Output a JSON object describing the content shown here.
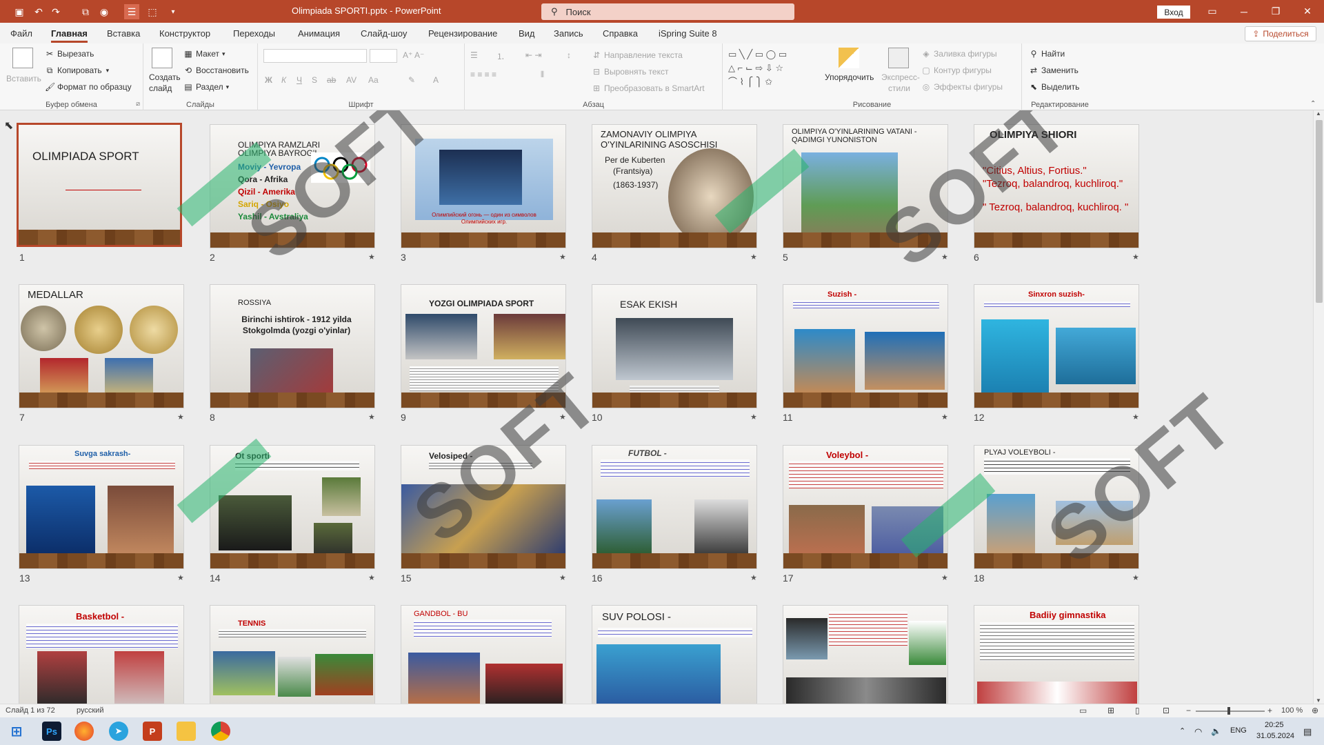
{
  "window": {
    "doc_title": "Olimpiada SPORTI.pptx - PowerPoint",
    "search_placeholder": "Поиск",
    "signin": "Вход"
  },
  "tabs": [
    "Файл",
    "Главная",
    "Вставка",
    "Конструктор",
    "Переходы",
    "Анимация",
    "Слайд-шоу",
    "Рецензирование",
    "Вид",
    "Запись",
    "Справка",
    "iSpring Suite 8"
  ],
  "share_label": "Поделиться",
  "ribbon": {
    "clipboard": {
      "label": "Буфер обмена",
      "paste": "Вставить",
      "cut": "Вырезать",
      "copy": "Копировать",
      "format_painter": "Формат по образцу"
    },
    "slides": {
      "label": "Слайды",
      "new_slide_1": "Создать",
      "new_slide_2": "слайд",
      "layout": "Макет",
      "reset": "Восстановить",
      "section": "Раздел"
    },
    "font": {
      "label": "Шрифт"
    },
    "paragraph": {
      "label": "Абзац",
      "text_direction": "Направление текста",
      "align_text": "Выровнять текст",
      "smartart": "Преобразовать в SmartArt"
    },
    "drawing": {
      "label": "Рисование",
      "arrange": "Упорядочить",
      "quick_styles_1": "Экспресс-",
      "quick_styles_2": "стили",
      "fill": "Заливка фигуры",
      "outline": "Контур фигуры",
      "effects": "Эффекты фигуры"
    },
    "editing": {
      "label": "Редактирование",
      "find": "Найти",
      "replace": "Заменить",
      "select": "Выделить"
    }
  },
  "slides": [
    {
      "n": "1",
      "title": "OLIMPIADA SPORT"
    },
    {
      "n": "2",
      "title": "OLIMPIYA RAMZLARI"
    },
    {
      "n": "3",
      "title": ""
    },
    {
      "n": "4",
      "title": "ZAMONAVIY OLIMPIYA"
    },
    {
      "n": "5",
      "title": "OLIMPIYA O'YINLARINING VATANI -"
    },
    {
      "n": "6",
      "title": "OLIMPIYA SHIORI"
    },
    {
      "n": "7",
      "title": "MEDALLAR"
    },
    {
      "n": "8",
      "title": "ROSSIYA"
    },
    {
      "n": "9",
      "title": "YOZGI OLIMPIADA SPORT"
    },
    {
      "n": "10",
      "title": "ESAK EKISH"
    },
    {
      "n": "11",
      "title": "Suzish -"
    },
    {
      "n": "12",
      "title": "Sinxron suzish-"
    },
    {
      "n": "13",
      "title": "Suvga sakrash-"
    },
    {
      "n": "14",
      "title": "Ot sporti"
    },
    {
      "n": "15",
      "title": "Velosiped -"
    },
    {
      "n": "16",
      "title": "FUTBOL -"
    },
    {
      "n": "17",
      "title": "Voleybol -"
    },
    {
      "n": "18",
      "title": "PLYAJ VOLEYBOLI -"
    },
    {
      "n": "19",
      "title": "Basketbol -"
    },
    {
      "n": "20",
      "title": "TENNIS"
    },
    {
      "n": "21",
      "title": "GANDBOL - BU"
    },
    {
      "n": "22",
      "title": "SUV POLOSI -"
    },
    {
      "n": "23",
      "title": ""
    },
    {
      "n": "24",
      "title": "Badiiy gimnastika"
    }
  ],
  "slide_text": {
    "s2_sub": "OLIMPIYA BAYROG'I",
    "s2_lines": [
      "Moviy - Yevropa",
      "Qora - Afrika",
      "Qizil - Amerika",
      "Sariq - Osiyo",
      "Yashil - Avstraliya"
    ],
    "s3_caption": "Олимпийский огонь — один из символов Олимпийских игр.",
    "s4_sub": "O'YINLARINING ASOSCHISI",
    "s4_person": "Per de Kuberten",
    "s4_country": "(Frantsiya)",
    "s4_years": "(1863-1937)",
    "s5_sub": "QADIMGI YUNONISTON",
    "s6_lines": [
      "\"Citius, Altius, Fortius.\"",
      "\"Tezroq, balandroq, kuchliroq.\"",
      "\" Tezroq, balandroq, kuchliroq. \""
    ],
    "s8_text": "Birinchi ishtirok - 1912 yilda Stokgolmda (yozgi o'yinlar)"
  },
  "status": {
    "slide_info": "Слайд 1 из 72",
    "language": "русский",
    "zoom": "100 %"
  },
  "taskbar": {
    "lang": "ENG",
    "time": "20:25",
    "date": "31.05.2024"
  },
  "colors": {
    "accent": "#b7472a",
    "text_red": "#c00000"
  }
}
